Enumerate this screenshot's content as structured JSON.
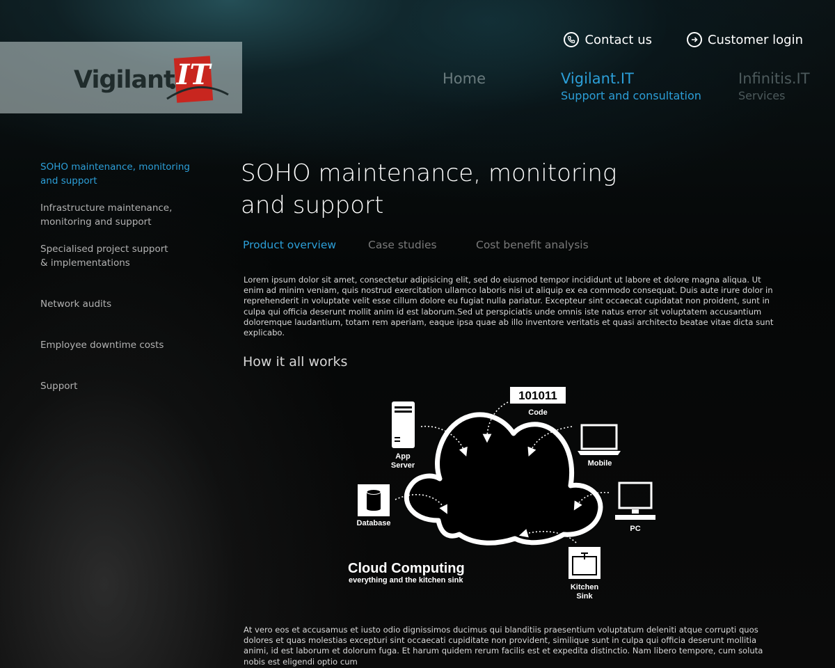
{
  "header": {
    "contact_label": "Contact us",
    "login_label": "Customer login",
    "logo_text": "Vigilant",
    "logo_badge": "IT"
  },
  "nav": {
    "home": {
      "label": "Home",
      "sub": ""
    },
    "vigilant": {
      "label": "Vigilant.IT",
      "sub": "Support and consultation"
    },
    "infinitis": {
      "label": "Infinitis.IT",
      "sub": "Services"
    }
  },
  "sidebar": {
    "items": [
      {
        "line1": "SOHO maintenance, monitoring",
        "line2": "and support"
      },
      {
        "line1": "Infrastructure maintenance,",
        "line2": "monitoring and support"
      },
      {
        "line1": "Specialised project support",
        "line2": "& implementations"
      },
      {
        "line1": "Network audits",
        "line2": ""
      },
      {
        "line1": "Employee downtime costs",
        "line2": ""
      },
      {
        "line1": "Support",
        "line2": ""
      }
    ]
  },
  "main": {
    "title_line1": "SOHO maintenance, monitoring",
    "title_line2": "and support",
    "tabs": [
      {
        "label": "Product overview"
      },
      {
        "label": "Case studies"
      },
      {
        "label": "Cost benefit analysis"
      }
    ],
    "intro_lines": [
      "Lorem ipsum dolor sit amet, consectetur adipisicing elit, sed do eiusmod tempor incididunt ut labore et dolore magna aliqua. Ut",
      "enim ad minim veniam, quis nostrud exercitation ullamco laboris nisi ut aliquip ex ea commodo consequat. Duis aute irure dolor in",
      "reprehenderit in voluptate velit esse cillum dolore eu fugiat nulla pariatur. Excepteur sint occaecat cupidatat non proident, sunt in",
      "culpa qui officia deserunt mollit anim id est laborum.Sed ut perspiciatis unde omnis iste natus error sit voluptatem accusantium",
      "doloremque laudantium, totam rem aperiam, eaque ipsa quae ab illo inventore veritatis et quasi architecto beatae vitae dicta sunt",
      "explicabo."
    ],
    "section_heading": "How it all works",
    "outro_lines": [
      "At vero eos et accusamus et iusto odio dignissimos ducimus qui blanditiis praesentium voluptatum deleniti atque corrupti quos",
      "dolores et quas molestias excepturi sint occaecati cupiditate non provident, similique sunt in culpa qui officia deserunt mollitia",
      "animi, id est laborum et dolorum fuga. Et harum quidem rerum facilis est et expedita distinctio. Nam libero tempore, cum soluta",
      "nobis est eligendi optio cum"
    ]
  },
  "diagram": {
    "code_value": "101011",
    "code_label": "Code",
    "app_server_line1": "App",
    "app_server_line2": "Server",
    "mobile_label": "Mobile",
    "database_label": "Database",
    "pc_label": "PC",
    "kitchen_line1": "Kitchen",
    "kitchen_line2": "Sink",
    "title": "Cloud Computing",
    "subtitle": "everything and the kitchen sink"
  },
  "colors": {
    "accent": "#2c9fd8",
    "logo_red": "#c8261f"
  }
}
